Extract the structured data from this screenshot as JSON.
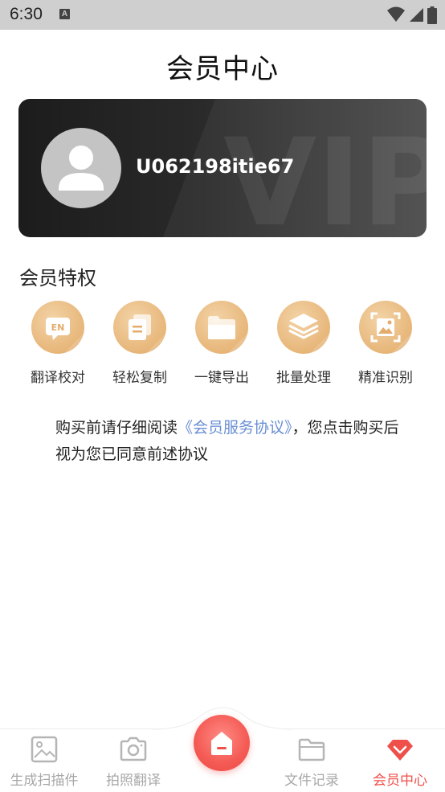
{
  "status_bar": {
    "time": "6:30",
    "notification_icon": "a-icon",
    "icons": [
      "wifi-icon",
      "signal-icon",
      "battery-icon"
    ]
  },
  "page": {
    "title": "会员中心"
  },
  "vip_card": {
    "username": "U062198itie67",
    "watermark": "VIP",
    "avatar_icon": "user-avatar-icon"
  },
  "privileges": {
    "title": "会员特权",
    "items": [
      {
        "label": "翻译校对",
        "icon": "en-translate-icon",
        "icon_text": "EN"
      },
      {
        "label": "轻松复制",
        "icon": "copy-icon"
      },
      {
        "label": "一键导出",
        "icon": "folder-icon"
      },
      {
        "label": "批量处理",
        "icon": "layers-icon"
      },
      {
        "label": "精准识别",
        "icon": "scan-image-icon"
      }
    ]
  },
  "agreement": {
    "before": "购买前请仔细阅读",
    "link": "《会员服务协议》",
    "after": "，您点击购买后视为您已同意前述协议"
  },
  "bottom_nav": {
    "items": [
      {
        "label": "生成扫描件",
        "icon": "image-icon",
        "active": false
      },
      {
        "label": "拍照翻译",
        "icon": "camera-icon",
        "active": false
      },
      {
        "label": "文件记录",
        "icon": "folder-icon",
        "active": false
      },
      {
        "label": "会员中心",
        "icon": "diamond-icon",
        "active": true
      }
    ],
    "center_icon": "home-icon"
  },
  "colors": {
    "accent": "#f0504a",
    "gold": "#e7b679",
    "link": "#6a8fd3",
    "card_dark": "#1c1c1c",
    "inactive_nav": "#a8a8a8"
  }
}
